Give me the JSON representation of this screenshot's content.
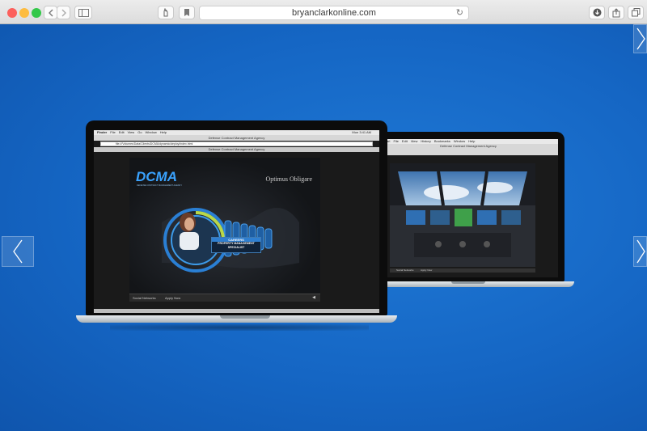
{
  "browser": {
    "url": "bryanclarkonline.com",
    "lights": {
      "close": "#fc605c",
      "minimize": "#fdbc40",
      "zoom": "#34c84a"
    }
  },
  "page": {
    "background": "#1565c0"
  },
  "front_laptop": {
    "menubar": [
      "Finder",
      "File",
      "Edit",
      "View",
      "Go",
      "Window",
      "Help"
    ],
    "clock": "Mon 3:41 AM",
    "window_title": "Defense Contract Management Agency",
    "address": "file:///Volumes/Data/Clients/DCMA/dynamic/deploy/index.html",
    "tab_title": "Defense Contract Management Agency",
    "logo": "DCMA",
    "logo_subtitle": "DEFENSE CONTRACT MANAGEMENT AGENCY",
    "tagline": "Optimus Obligare",
    "career_header": "CAREERS",
    "career_title": "PROPERTY MANAGEMENT SPECIALIST",
    "nav_left": "Social Networks",
    "nav_right": "Apply Now"
  },
  "back_laptop": {
    "menubar": [
      "Safari",
      "File",
      "Edit",
      "View",
      "History",
      "Bookmarks",
      "Window",
      "Help"
    ],
    "window_title": "Defense Contract Management Agency",
    "nav_left": "Social Networks",
    "nav_right": "Apply Now"
  }
}
